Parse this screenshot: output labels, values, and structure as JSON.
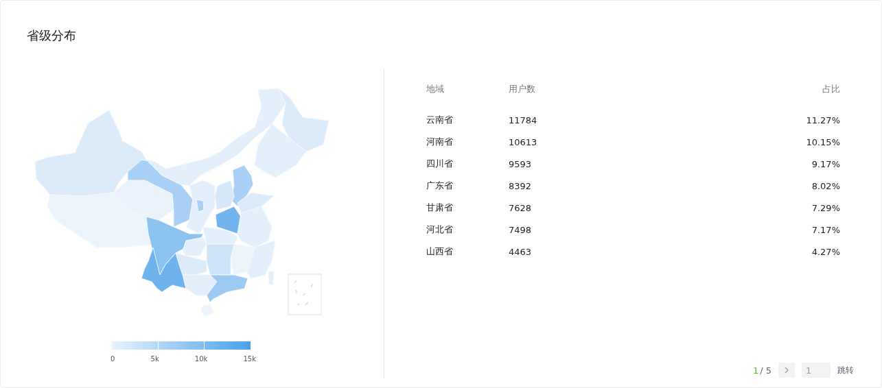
{
  "title": "省级分布",
  "legend": {
    "ticks": [
      "0",
      "5k",
      "10k",
      "15k"
    ]
  },
  "table": {
    "columns": [
      "地域",
      "用户数",
      "占比"
    ],
    "rows": [
      {
        "region": "云南省",
        "users": "11784",
        "share": "11.27%"
      },
      {
        "region": "河南省",
        "users": "10613",
        "share": "10.15%"
      },
      {
        "region": "四川省",
        "users": "9593",
        "share": "9.17%"
      },
      {
        "region": "广东省",
        "users": "8392",
        "share": "8.02%"
      },
      {
        "region": "甘肃省",
        "users": "7628",
        "share": "7.29%"
      },
      {
        "region": "河北省",
        "users": "7498",
        "share": "7.17%"
      },
      {
        "region": "山西省",
        "users": "4463",
        "share": "4.27%"
      }
    ]
  },
  "pagination": {
    "current": "1",
    "total": "/ 5",
    "jump_value": "1",
    "jump_label": "跳转"
  }
}
